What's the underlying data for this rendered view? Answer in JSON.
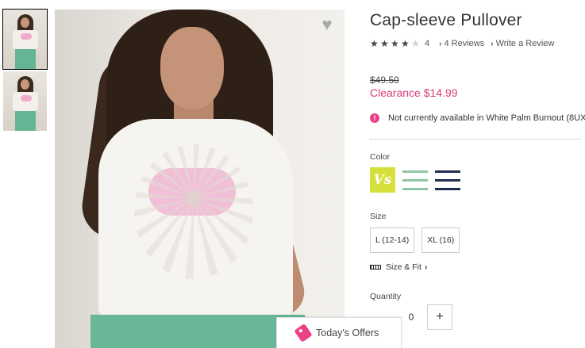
{
  "product": {
    "title": "Cap-sleeve Pullover",
    "rating": {
      "value": 4,
      "max": 5,
      "count_label": "4",
      "reviews_label": "4 Reviews",
      "write_review_label": "Write a Review"
    },
    "old_price": "$49.50",
    "sale_price": "Clearance $14.99",
    "availability_notice": "Not currently available in White Palm Burnout (8UX",
    "color_label": "Color",
    "colors": [
      {
        "name": "white-palm-burnout",
        "swatch_text": "Vs",
        "selected": true
      },
      {
        "name": "green-stripe",
        "swatch_text": "",
        "selected": false
      },
      {
        "name": "navy-stripe",
        "swatch_text": "",
        "selected": false
      }
    ],
    "size_label": "Size",
    "sizes": [
      "L (12-14)",
      "XL (16)"
    ],
    "size_fit_label": "Size & Fit",
    "quantity_label": "Quantity",
    "quantity_value": "0"
  },
  "offers": {
    "label": "Today's Offers"
  },
  "colors": {
    "accent_pink": "#d93c7a",
    "notice_icon": "#e83f86",
    "swatch_yellow": "#d6e03a"
  },
  "icons": {
    "favorite": "heart-icon",
    "notice": "exclamation-icon",
    "fit": "ruler-icon",
    "offers": "tag-icon"
  }
}
